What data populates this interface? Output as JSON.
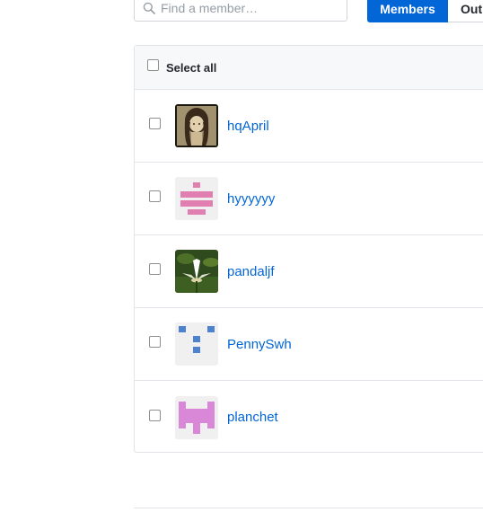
{
  "search": {
    "placeholder": "Find a member…",
    "icon": "search-icon"
  },
  "tabs": [
    {
      "label": "Members",
      "active": true
    },
    {
      "label": "Outside collaborators",
      "visible_text": "Out",
      "active": false
    }
  ],
  "list": {
    "select_all_label": "Select all",
    "members": [
      {
        "username": "hqApril",
        "avatar": "photo-girl"
      },
      {
        "username": "hyyyyyy",
        "avatar": "identicon-pink"
      },
      {
        "username": "pandaljf",
        "avatar": "photo-lotus"
      },
      {
        "username": "PennySwh",
        "avatar": "identicon-blue"
      },
      {
        "username": "planchet",
        "avatar": "identicon-violet"
      }
    ]
  },
  "colors": {
    "accent": "#0366d6",
    "link": "#0366d6",
    "border": "#e1e4e8",
    "header_bg": "#f6f8fa"
  }
}
